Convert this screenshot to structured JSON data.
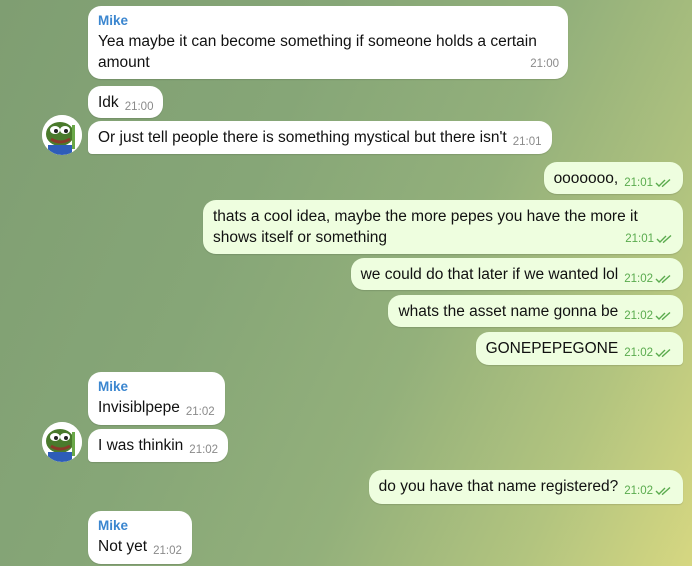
{
  "theme": {
    "incoming_bg": "#ffffff",
    "outgoing_bg": "#eefedf",
    "sender_color": "#3b86cf",
    "tick_color": "#5aab4e"
  },
  "messages": [
    {
      "sender": "Mike",
      "line1": "Yea maybe it can become something if someone holds a certain",
      "line2": "amount",
      "time": "21:00"
    },
    {
      "text": "Idk",
      "time": "21:00"
    },
    {
      "text": "Or just tell people there is something mystical  but there isn't",
      "time": "21:01"
    },
    {
      "text": "ooooooo,",
      "time": "21:01"
    },
    {
      "line1": "thats a cool idea, maybe the more pepes you have the more it",
      "line2": "shows itself or something",
      "time": "21:01"
    },
    {
      "text": "we could do that later if we wanted lol",
      "time": "21:02"
    },
    {
      "text": "whats the asset name gonna be",
      "time": "21:02"
    },
    {
      "text": "GONEPEPEGONE",
      "time": "21:02"
    },
    {
      "sender": "Mike",
      "text": "Invisiblpepe",
      "time": "21:02"
    },
    {
      "text": "I was thinkin",
      "time": "21:02"
    },
    {
      "text": "do you have that name registered?",
      "time": "21:02"
    },
    {
      "sender": "Mike",
      "text": "Not yet",
      "time": "21:02"
    }
  ]
}
